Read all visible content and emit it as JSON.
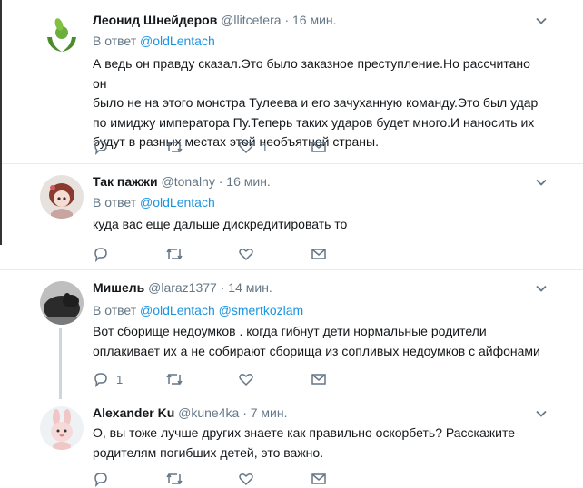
{
  "reply_prefix": "В ответ",
  "tweets": [
    {
      "name": "Леонид Шнейдеров",
      "handle": "@llitcetera",
      "time": "16 мин.",
      "mentions": [
        "@oldLentach"
      ],
      "text_lines": [
        "А ведь он правду сказал.Это было заказное преступление.Но рассчитано он",
        "было не на этого монстра Тулеева и его зачуханную команду.Это был удар",
        "по имиджу императора Пу.Теперь таких ударов будет много.И наносить их",
        "будут в разных местах этой необъятной страны."
      ],
      "reply_count": "",
      "retweet_count": "",
      "like_count": "1",
      "avatar_icon": "leaf-hands-logo-icon"
    },
    {
      "name": "Так пажжи",
      "handle": "@tonalny",
      "time": "16 мин.",
      "mentions": [
        "@oldLentach"
      ],
      "text_lines": [
        "куда вас еще дальше дискредитировать то"
      ],
      "reply_count": "",
      "retweet_count": "",
      "like_count": "",
      "avatar_icon": "anime-girl-avatar-icon"
    },
    {
      "name": "Мишель",
      "handle": "@laraz1377",
      "time": "14 мин.",
      "mentions": [
        "@oldLentach",
        "@smertkozlam"
      ],
      "text_lines": [
        "Вот сборище недоумков . когда гибнут дети нормальные родители",
        "оплакивает их а не собирают сборища из сопливых недоумков с айфонами"
      ],
      "reply_count": "1",
      "retweet_count": "",
      "like_count": "",
      "avatar_icon": "bear-avatar-icon"
    },
    {
      "name": "Alexander Ku",
      "handle": "@kune4ka",
      "time": "7 мин.",
      "mentions": [],
      "text_lines": [
        "О, вы тоже лучше других знаете как правильно оскорбеть? Расскажите",
        "родителям погибших детей, это важно."
      ],
      "reply_count": "",
      "retweet_count": "",
      "like_count": "",
      "avatar_icon": "bunny-avatar-icon"
    }
  ],
  "colors": {
    "text": "#14171a",
    "muted": "#657786",
    "link": "#1b95e0",
    "divider": "#e6ecf0",
    "thread": "#ccd6dd"
  }
}
